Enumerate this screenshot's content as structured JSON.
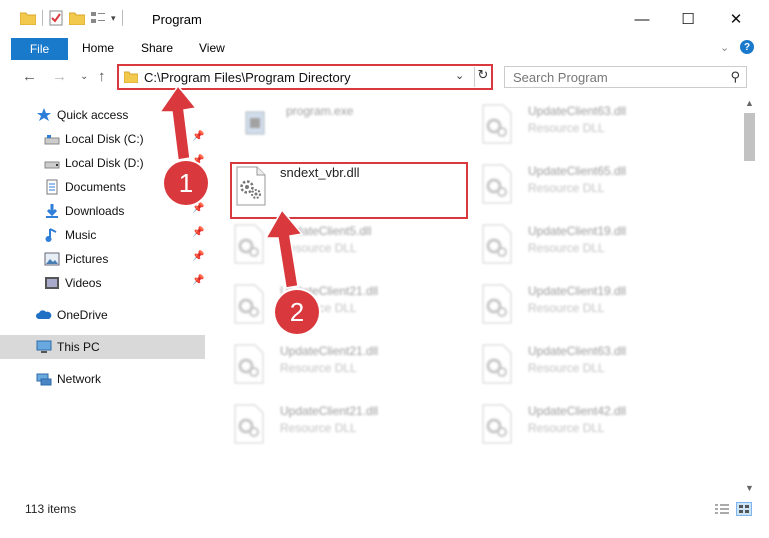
{
  "window": {
    "title": "Program",
    "minimize_glyph": "—",
    "maximize_glyph": "☐",
    "close_glyph": "✕"
  },
  "ribbon": {
    "file_label": "File",
    "tabs": [
      "Home",
      "Share",
      "View"
    ],
    "expand_glyph": "⌄",
    "help_glyph": "?"
  },
  "nav": {
    "back_glyph": "←",
    "forward_glyph": "→",
    "recent_glyph": "⌄",
    "up_glyph": "↑",
    "address_path": "C:\\Program Files\\Program Directory",
    "address_dropdown_glyph": "⌄",
    "refresh_glyph": "↻",
    "search_placeholder": "Search Program",
    "search_glyph": "⚲"
  },
  "sidebar": {
    "items": [
      {
        "label": "Quick access",
        "icon": "star-icon",
        "pinned": false
      },
      {
        "label": "Local Disk (C:)",
        "icon": "drive-icon",
        "pinned": true
      },
      {
        "label": "Local Disk (D:)",
        "icon": "drive-icon",
        "pinned": true
      },
      {
        "label": "Documents",
        "icon": "documents-icon",
        "pinned": true
      },
      {
        "label": "Downloads",
        "icon": "download-icon",
        "pinned": true
      },
      {
        "label": "Music",
        "icon": "music-icon",
        "pinned": true
      },
      {
        "label": "Pictures",
        "icon": "pictures-icon",
        "pinned": true
      },
      {
        "label": "Videos",
        "icon": "videos-icon",
        "pinned": true
      },
      {
        "label": "OneDrive",
        "icon": "cloud-icon",
        "pinned": false
      },
      {
        "label": "This PC",
        "icon": "computer-icon",
        "pinned": false,
        "selected": true
      },
      {
        "label": "Network",
        "icon": "network-icon",
        "pinned": false
      }
    ],
    "pin_glyph": "📌"
  },
  "files": [
    {
      "name": "program.exe",
      "type": "",
      "icon": "exe-icon",
      "faded": true
    },
    {
      "name": "UpdateClient63.dll",
      "type": "Resource DLL",
      "icon": "dll-icon",
      "faded": true
    },
    {
      "name": "sndext_vbr.dll",
      "type": "",
      "icon": "dll-icon",
      "faded": false
    },
    {
      "name": "UpdateClient65.dll",
      "type": "Resource DLL",
      "icon": "dll-icon",
      "faded": true
    },
    {
      "name": "UpdateClient5.dll",
      "type": "Resource DLL",
      "icon": "dll-icon",
      "faded": true
    },
    {
      "name": "UpdateClient19.dll",
      "type": "Resource DLL",
      "icon": "dll-icon",
      "faded": true
    },
    {
      "name": "UpdateClient21.dll",
      "type": "Resource DLL",
      "icon": "dll-icon",
      "faded": true
    },
    {
      "name": "UpdateClient19.dll",
      "type": "Resource DLL",
      "icon": "dll-icon",
      "faded": true
    },
    {
      "name": "UpdateClient21.dll",
      "type": "Resource DLL",
      "icon": "dll-icon",
      "faded": true
    },
    {
      "name": "UpdateClient63.dll",
      "type": "Resource DLL",
      "icon": "dll-icon",
      "faded": true
    },
    {
      "name": "UpdateClient21.dll",
      "type": "Resource DLL",
      "icon": "dll-icon",
      "faded": true
    },
    {
      "name": "UpdateClient42.dll",
      "type": "Resource DLL",
      "icon": "dll-icon",
      "faded": true
    }
  ],
  "annotations": {
    "step1": "1",
    "step2": "2",
    "highlight_color": "#d9383c"
  },
  "status": {
    "item_count": "113 items"
  },
  "colors": {
    "accent": "#1979ca",
    "annotation_red": "#d9383c",
    "selected_bg": "#d9d9d9"
  }
}
